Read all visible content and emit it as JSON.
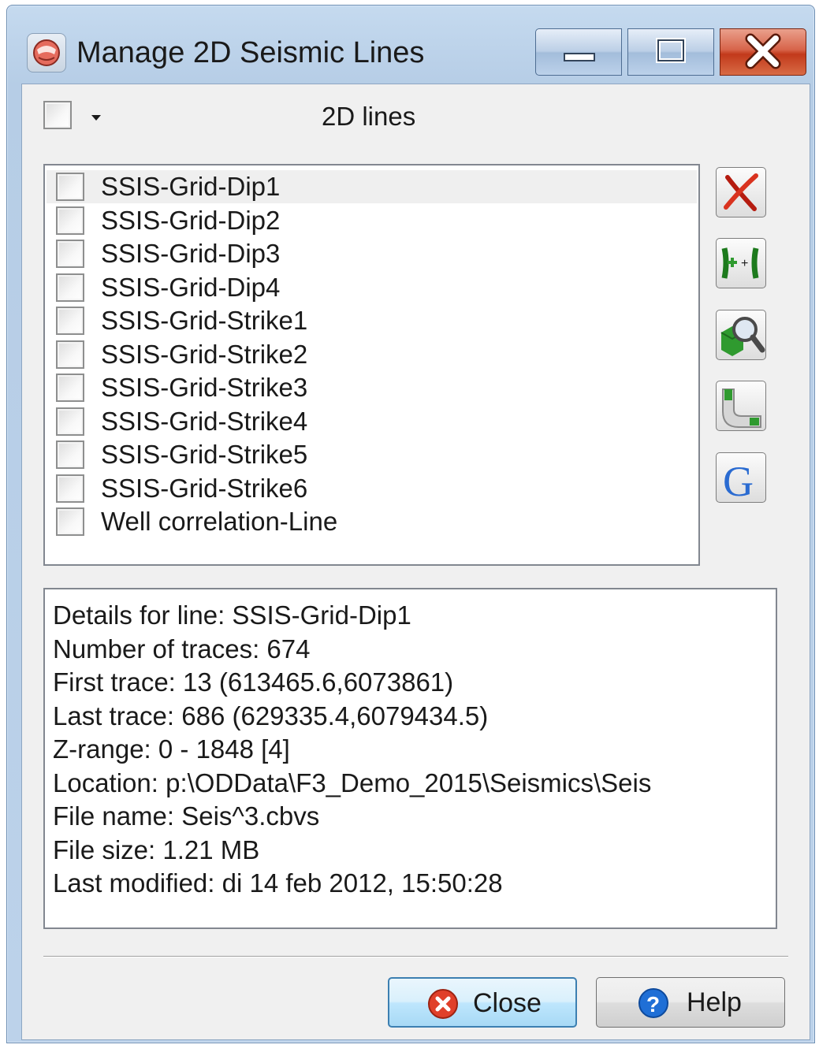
{
  "window": {
    "title": "Manage 2D Seismic Lines",
    "icon": "opendtect-app-icon",
    "controls": [
      "minimize-icon",
      "maximize-icon",
      "close-icon"
    ]
  },
  "header": {
    "label": "2D lines",
    "select_all_checked": false
  },
  "lines": [
    {
      "label": "SSIS-Grid-Dip1",
      "checked": false,
      "selected": true
    },
    {
      "label": "SSIS-Grid-Dip2",
      "checked": false
    },
    {
      "label": "SSIS-Grid-Dip3",
      "checked": false
    },
    {
      "label": "SSIS-Grid-Dip4",
      "checked": false
    },
    {
      "label": "SSIS-Grid-Strike1",
      "checked": false
    },
    {
      "label": "SSIS-Grid-Strike2",
      "checked": false
    },
    {
      "label": "SSIS-Grid-Strike3",
      "checked": false
    },
    {
      "label": "SSIS-Grid-Strike4",
      "checked": false
    },
    {
      "label": "SSIS-Grid-Strike5",
      "checked": false
    },
    {
      "label": "SSIS-Grid-Strike6",
      "checked": false
    },
    {
      "label": "Well correlation-Line",
      "checked": false
    }
  ],
  "tools": [
    {
      "name": "delete-icon"
    },
    {
      "name": "merge-lines-icon"
    },
    {
      "name": "browse-icon"
    },
    {
      "name": "geometry-icon"
    },
    {
      "name": "google-export-icon"
    }
  ],
  "details": {
    "line1": "Details for line: SSIS-Grid-Dip1",
    "line2": "Number of traces: 674",
    "line3": "First trace: 13 (613465.6,6073861)",
    "line4": "Last trace: 686 (629335.4,6079434.5)",
    "line5": "Z-range: 0 - 1848 [4]",
    "line6": "Location: p:\\ODData\\F3_Demo_2015\\Seismics\\Seis",
    "line7": "File name: Seis^3.cbvs",
    "line8": "File size: 1.21 MB",
    "line9": "Last modified: di 14 feb 2012, 15:50:28"
  },
  "buttons": {
    "close_label": "Close",
    "help_label": "Help"
  },
  "colors": {
    "close_icon_red": "#d9331f",
    "help_icon_blue": "#1f6fd6",
    "tool_green": "#2f9a2f"
  }
}
